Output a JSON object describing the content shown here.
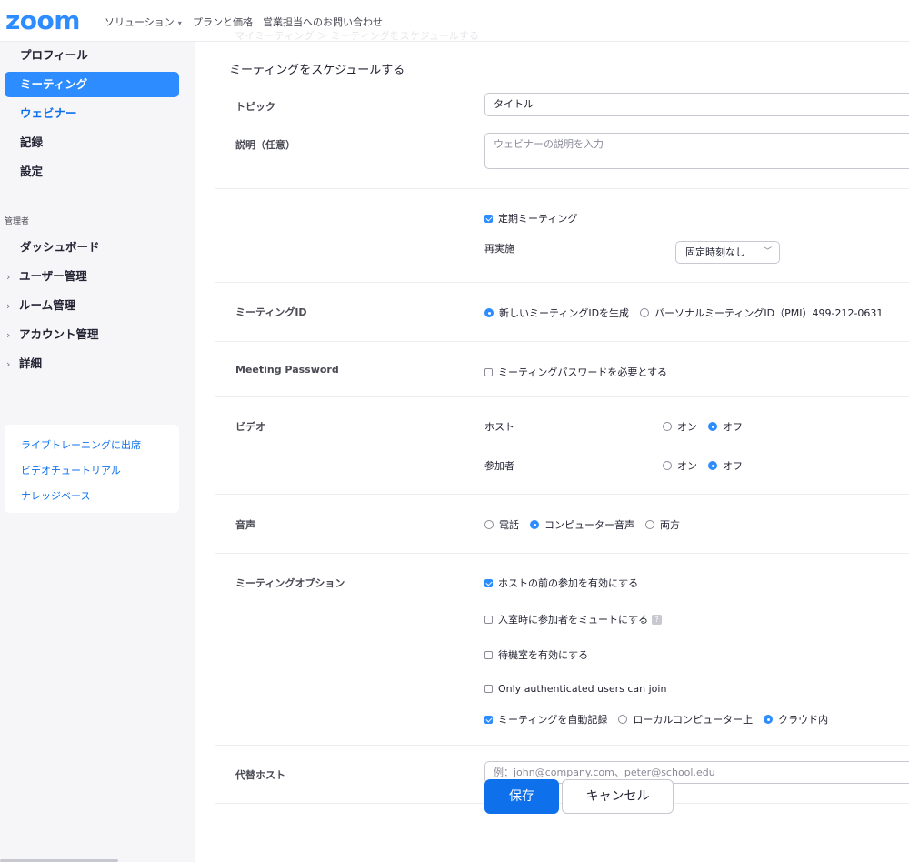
{
  "brand": {
    "logo": "zoom",
    "accent": "#2d8cff",
    "button_blue": "#0e71eb"
  },
  "topnav": {
    "solutions": "ソリューション",
    "plans": "プランと価格",
    "contact": "営業担当へのお問い合わせ"
  },
  "breadcrumb_faded": "マイミーティング ＞ ミーティングをスケジュールする",
  "sidebar": {
    "items": [
      {
        "label": "プロフィール"
      },
      {
        "label": "ミーティング",
        "active": true
      },
      {
        "label": "ウェビナー"
      },
      {
        "label": "記録"
      },
      {
        "label": "設定"
      }
    ],
    "admin_heading": "管理者",
    "admin_items": [
      {
        "label": "ダッシュボード"
      },
      {
        "label": "ユーザー管理"
      },
      {
        "label": "ルーム管理"
      },
      {
        "label": "アカウント管理"
      },
      {
        "label": "詳細"
      }
    ],
    "help_links": [
      "ライブトレーニングに出席",
      "ビデオチュートリアル",
      "ナレッジベース"
    ]
  },
  "form": {
    "title": "ミーティングをスケジュールする",
    "topic": {
      "label": "トピック",
      "value": "タイトル"
    },
    "description": {
      "label": "説明（任意）",
      "placeholder": "ウェビナーの説明を入力"
    },
    "recurring": {
      "label": "定期ミーティング",
      "checked": true
    },
    "recurrence": {
      "label": "再実施",
      "selected": "固定時刻なし"
    },
    "meeting_id": {
      "label": "ミーティングID",
      "options": [
        {
          "label": "新しいミーティングIDを生成",
          "selected": true
        },
        {
          "label": "パーソナルミーティングID（PMI）499-212-0631",
          "selected": false
        }
      ]
    },
    "password": {
      "label": "Meeting Password",
      "option": "ミーティングパスワードを必要とする",
      "checked": false
    },
    "video": {
      "label": "ビデオ",
      "host": {
        "label": "ホスト",
        "on": "オン",
        "off": "オフ",
        "value": "off"
      },
      "participant": {
        "label": "参加者",
        "on": "オン",
        "off": "オフ",
        "value": "off"
      }
    },
    "audio": {
      "label": "音声",
      "options": [
        {
          "label": "電話",
          "selected": false
        },
        {
          "label": "コンピューター音声",
          "selected": true
        },
        {
          "label": "両方",
          "selected": false
        }
      ]
    },
    "options": {
      "label": "ミーティングオプション",
      "join_before_host": {
        "label": "ホストの前の参加を有効にする",
        "checked": true
      },
      "mute_on_entry": {
        "label": "入室時に参加者をミュートにする",
        "checked": false
      },
      "waiting_room": {
        "label": "待機室を有効にする",
        "checked": false
      },
      "auth_only": {
        "label": "Only authenticated users can join",
        "checked": false
      },
      "auto_record": {
        "label": "ミーティングを自動記録",
        "checked": true
      },
      "record_local": {
        "label": "ローカルコンピューター上",
        "selected": false
      },
      "record_cloud": {
        "label": "クラウド内",
        "selected": true
      }
    },
    "alt_host": {
      "label": "代替ホスト",
      "placeholder": "例：john@company.com、peter@school.edu"
    },
    "save": "保存",
    "cancel": "キャンセル"
  }
}
